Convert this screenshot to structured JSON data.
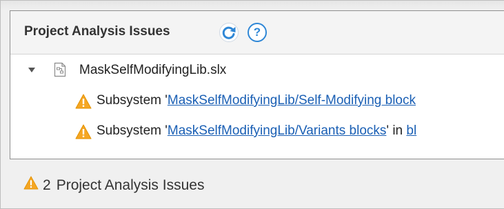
{
  "panel": {
    "title": "Project Analysis Issues",
    "refresh_icon": "refresh-icon",
    "help_icon": "help-icon",
    "help_label": "?"
  },
  "tree": {
    "file": {
      "name": "MaskSelfModifyingLib.slx",
      "icon": "simulink-model-file-icon",
      "expanded": true
    },
    "issues": [
      {
        "icon": "warning-icon",
        "prefix": "Subsystem '",
        "link": "MaskSelfModifyingLib/Self-Modifying block",
        "suffix": ""
      },
      {
        "icon": "warning-icon",
        "prefix": "Subsystem '",
        "link": "MaskSelfModifyingLib/Variants blocks",
        "suffix": "' in ",
        "link2": "bl"
      }
    ]
  },
  "footer": {
    "icon": "warning-icon",
    "count": "2",
    "label": "Project Analysis Issues"
  },
  "colors": {
    "link": "#1a5fb4",
    "warning": "#f5a623",
    "accent": "#2f87d6"
  }
}
